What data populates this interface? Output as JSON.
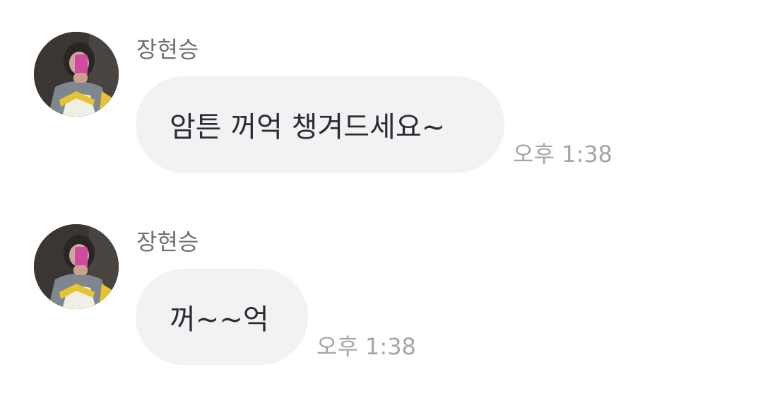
{
  "messages": [
    {
      "sender": "장현승",
      "text": "암튼 꺼억 챙겨드세요~",
      "time": "오후 1:38"
    },
    {
      "sender": "장현승",
      "text": "꺼~~억",
      "time": "오후 1:38"
    }
  ]
}
